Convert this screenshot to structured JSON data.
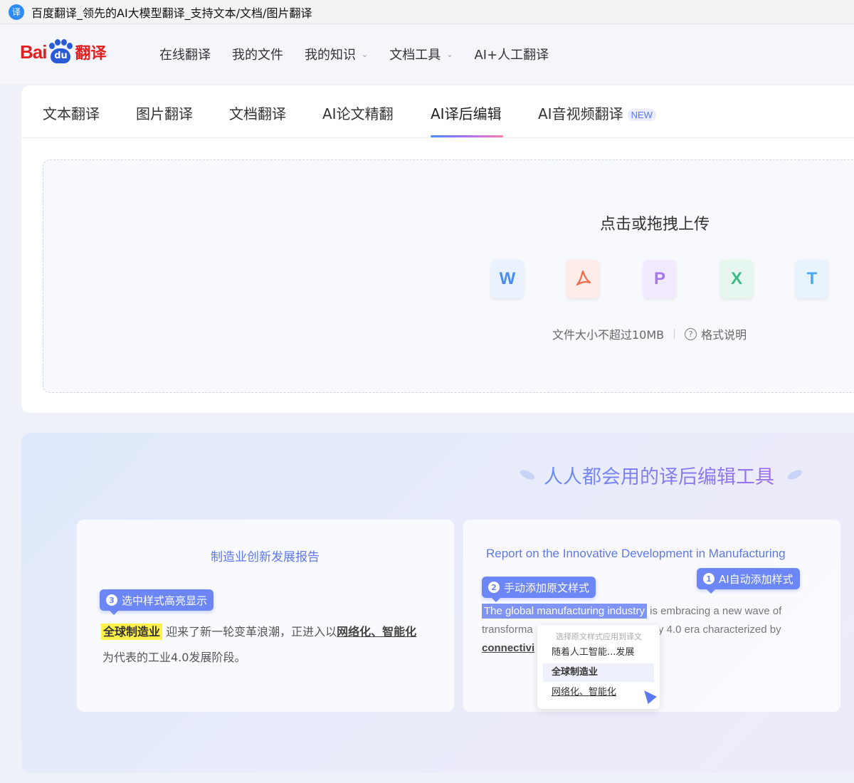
{
  "window": {
    "title": "百度翻译_领先的AI大模型翻译_支持文本/文档/图片翻译",
    "favicon_glyph": "译"
  },
  "logo": {
    "bai": "Bai",
    "du": "du",
    "fanyi": "翻译"
  },
  "nav": [
    {
      "label": "在线翻译",
      "has_dropdown": false
    },
    {
      "label": "我的文件",
      "has_dropdown": false
    },
    {
      "label": "我的知识",
      "has_dropdown": true
    },
    {
      "label": "文档工具",
      "has_dropdown": true
    },
    {
      "label": "AI+人工翻译",
      "has_dropdown": false
    }
  ],
  "tabs": [
    {
      "label": "文本翻译"
    },
    {
      "label": "图片翻译"
    },
    {
      "label": "文档翻译"
    },
    {
      "label": "AI论文精翻"
    },
    {
      "label": "AI译后编辑",
      "active": true
    },
    {
      "label": "AI音视频翻译",
      "badge": "NEW"
    }
  ],
  "upload": {
    "title": "点击或拖拽上传",
    "file_types": [
      {
        "letter": "W",
        "name": "word-icon",
        "color": "#4a8cf7"
      },
      {
        "letter": "PDF",
        "name": "pdf-icon",
        "color": "#f26a4b"
      },
      {
        "letter": "P",
        "name": "ppt-icon",
        "color": "#a774f2"
      },
      {
        "letter": "X",
        "name": "excel-icon",
        "color": "#3dbb86"
      },
      {
        "letter": "T",
        "name": "txt-icon",
        "color": "#49a9f5"
      }
    ],
    "size_limit": "文件大小不超过10MB",
    "format_help": "格式说明"
  },
  "promo": {
    "title": "人人都会用的译后编辑工具",
    "source_card": {
      "heading": "制造业创新发展报告",
      "step3_num": "3",
      "step3_label": "选中样式高亮显示",
      "highlight": "全球制造业",
      "text_a": "迎来了新一轮变革浪潮，正进入以",
      "underlined": "网络化、智能化",
      "text_b": "为代表的工业4.0发展阶段。"
    },
    "target_card": {
      "heading": "Report on the Innovative Development in Manufacturing",
      "step2_num": "2",
      "step2_label": "手动添加原文样式",
      "step1_num": "1",
      "step1_label": "AI自动添加样式",
      "highlight": "The global manufacturing industry",
      "text_a": "is embracing a new wave of",
      "text_b_start": "transforma",
      "text_b_end": "y 4.0 era characterized by",
      "text_c": "connectivi",
      "popup": {
        "hint": "选择原文样式应用到译文",
        "options": [
          "随着人工智能...发展",
          "全球制造业",
          "网络化、智能化"
        ],
        "selected_index": 1
      }
    }
  }
}
